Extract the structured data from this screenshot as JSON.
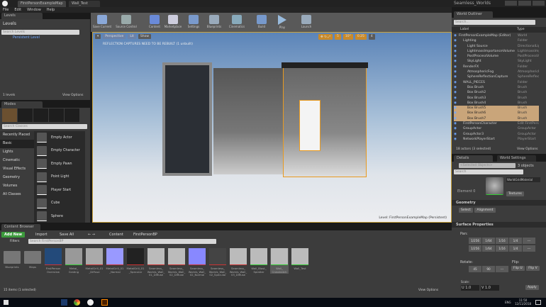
{
  "window": {
    "tabs": [
      "FirstPersonExampleMap",
      "Wall_Test"
    ],
    "project": "Seamless_Worlds"
  },
  "menu": [
    "File",
    "Edit",
    "Window",
    "Help"
  ],
  "levels": {
    "tab": "Levels",
    "title": "Levels",
    "search_placeholder": "Search Levels",
    "items": [
      "Persistent Level"
    ],
    "footer": "1 levels",
    "view_options": "View Options"
  },
  "modes": {
    "tab": "Modes",
    "search_placeholder": "Search Classes",
    "categories": [
      "Recently Placed",
      "Basic",
      "Lights",
      "Cinematic",
      "Visual Effects",
      "Geometry",
      "Volumes",
      "All Classes"
    ],
    "items": [
      "Empty Actor",
      "Empty Character",
      "Empty Pawn",
      "Point Light",
      "Player Start",
      "Cube",
      "Sphere"
    ]
  },
  "toolbar": [
    "Save Current",
    "Source Control",
    "Content",
    "Marketplace",
    "Settings",
    "Blueprints",
    "Cinematics",
    "Build",
    "Play",
    "Launch"
  ],
  "viewport": {
    "perspective": "Perspective",
    "lit": "Lit",
    "show": "Show",
    "warning": "REFLECTION CAPTURES NEED TO BE REBUILT (1 unbuilt)",
    "grid": "5",
    "angle": "10°",
    "scale": "0.25",
    "camera_speed": "4",
    "level_label": "Level: FirstPersonExampleMap (Persistent)"
  },
  "outliner": {
    "tab": "World Outliner",
    "search_placeholder": "Search...",
    "col_label": "Label",
    "col_type": "Type",
    "rows": [
      {
        "label": "FirstPersonExampleMap (Editor)",
        "type": "World",
        "indent": 0
      },
      {
        "label": "Lighting",
        "type": "Folder",
        "indent": 1
      },
      {
        "label": "Light Source",
        "type": "DirectionalLight",
        "indent": 2
      },
      {
        "label": "LightmassImportanceVolume",
        "type": "LightmassImportanceVolume",
        "indent": 2
      },
      {
        "label": "PostProcessVolume",
        "type": "PostProcessVolume",
        "indent": 2
      },
      {
        "label": "SkyLight",
        "type": "SkyLight",
        "indent": 2
      },
      {
        "label": "RenderFX",
        "type": "Folder",
        "indent": 1
      },
      {
        "label": "AtmosphericFog",
        "type": "AtmosphericFog",
        "indent": 2
      },
      {
        "label": "SphereReflectionCapture",
        "type": "SphereReflectionCapture",
        "indent": 2
      },
      {
        "label": "WALL_PIECES",
        "type": "Folder",
        "indent": 1
      },
      {
        "label": "Box Brush",
        "type": "Brush",
        "indent": 2
      },
      {
        "label": "Box Brush2",
        "type": "Brush",
        "indent": 2
      },
      {
        "label": "Box Brush3",
        "type": "Brush",
        "indent": 2
      },
      {
        "label": "Box Brush4",
        "type": "Brush",
        "indent": 2
      },
      {
        "label": "Box Brush5",
        "type": "Brush",
        "indent": 2,
        "selected": true
      },
      {
        "label": "Box Brush6",
        "type": "Brush",
        "indent": 2,
        "selected": true
      },
      {
        "label": "Box Brush7",
        "type": "Brush",
        "indent": 2,
        "selected": true
      },
      {
        "label": "FirstPersonCharacter",
        "type": "Edit FirstPersonCharacter",
        "indent": 1
      },
      {
        "label": "GroupActor",
        "type": "GroupActor",
        "indent": 1
      },
      {
        "label": "GroupActor3",
        "type": "GroupActor",
        "indent": 1
      },
      {
        "label": "NetworkPlayerStart",
        "type": "PlayerStart",
        "indent": 1
      }
    ],
    "footer": "18 actors (3 selected)",
    "view_options": "View Options"
  },
  "details": {
    "tabs": [
      "Details",
      "World Settings"
    ],
    "selected": "<Selected Objects>",
    "count": "3 objects",
    "search_placeholder": "Search",
    "element": "Element 0",
    "material": "WorldGridMaterial",
    "textures": "Textures",
    "geometry": "Geometry",
    "select": "Select",
    "alignment": "Alignment",
    "surface": "Surface Properties",
    "pan": "Pan:",
    "pan_values": [
      "1/256",
      "1/64",
      "1/16",
      "1/4",
      "---"
    ],
    "rotate": "Rotate:",
    "rotate_values": [
      "45",
      "90",
      "---"
    ],
    "flip": "Flip:",
    "flip_u": "Flip U",
    "flip_v": "Flip V",
    "scale": "Scale:",
    "u": "U  1.0",
    "v": "V  1.0",
    "apply": "Apply"
  },
  "content": {
    "tab": "Content Browser",
    "add_new": "Add New",
    "import": "Import",
    "save_all": "Save All",
    "path": [
      "Content",
      "FirstPersonBP"
    ],
    "search_placeholder": "Search FirstPersonBP",
    "filters": "Filters",
    "assets": [
      "Blueprints",
      "Maps",
      "FirstPerson Overview",
      "Metal_ Grating",
      "MetalGrill_01 _Diffuse",
      "MetalGrill_01 _Normal",
      "MetalGrill_01 _Specular",
      "Seamless_ Worlds_Wall_ 01_Diffuse",
      "Seamless_ Worlds_Wall_ 02_Diffuse",
      "Seamless_ Worlds_Wall_ 02_Normal",
      "Seamless_ Worlds_Wall_ 02_Specular",
      "Seamless_ Worlds_Wall_ 03_Diffuse",
      "Wall_Blast_ Splatter",
      "Wall_ Crosshatch",
      "Wall_Test"
    ],
    "footer": "15 items (1 selected)",
    "view_options": "View Options"
  },
  "taskbar": {
    "lang": "ENG",
    "time": "11:50",
    "date": "12/11/2018"
  },
  "colors": {
    "accent": "#c9a57a",
    "add_new": "#3c9a3c",
    "sky": "#6f93bf"
  }
}
